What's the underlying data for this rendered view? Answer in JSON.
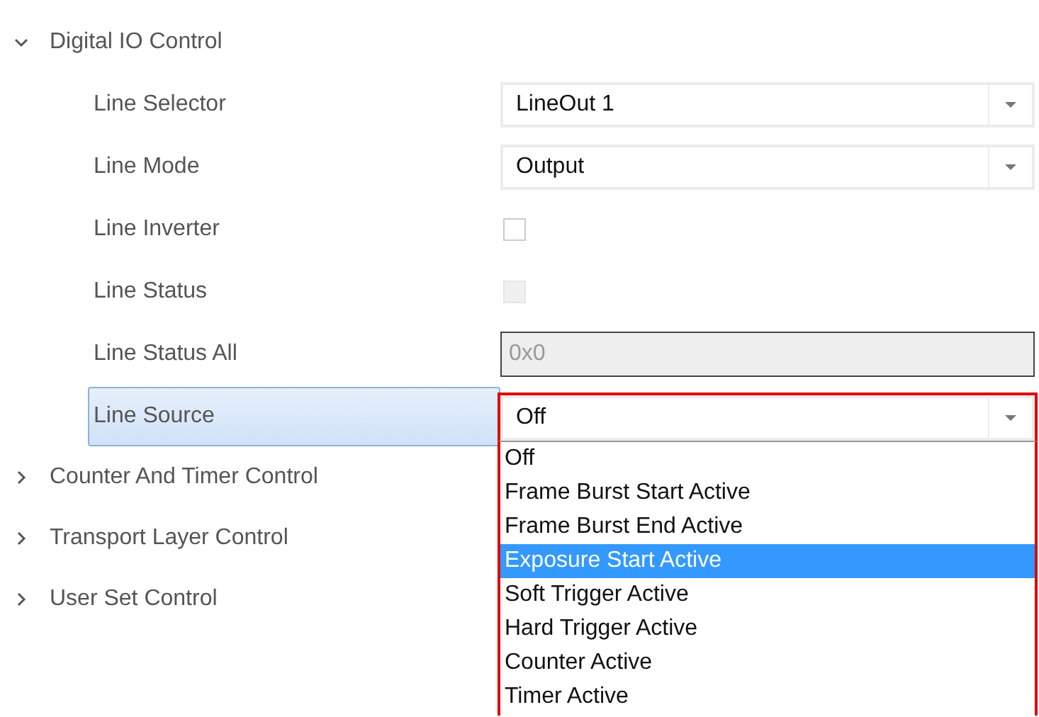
{
  "groups": [
    {
      "label": "Digital IO Control",
      "expanded": true,
      "properties": [
        {
          "kind": "dropdown",
          "label": "Line Selector",
          "value": "LineOut 1",
          "selected": false,
          "open": false
        },
        {
          "kind": "dropdown",
          "label": "Line Mode",
          "value": "Output",
          "selected": false,
          "open": false
        },
        {
          "kind": "checkbox",
          "label": "Line Inverter",
          "checked": false,
          "disabled": false,
          "selected": false
        },
        {
          "kind": "checkbox",
          "label": "Line Status",
          "checked": false,
          "disabled": true,
          "selected": false
        },
        {
          "kind": "readonly",
          "label": "Line Status All",
          "value": "0x0",
          "disabled": true,
          "selected": false
        },
        {
          "kind": "dropdown",
          "label": "Line Source",
          "value": "Off",
          "selected": true,
          "open": true,
          "options": [
            {
              "label": "Off",
              "highlighted": false
            },
            {
              "label": "Frame Burst Start Active",
              "highlighted": false
            },
            {
              "label": "Frame Burst End Active",
              "highlighted": false
            },
            {
              "label": "Exposure Start Active",
              "highlighted": true
            },
            {
              "label": "Soft Trigger Active",
              "highlighted": false
            },
            {
              "label": "Hard Trigger Active",
              "highlighted": false
            },
            {
              "label": "Counter Active",
              "highlighted": false
            },
            {
              "label": "Timer Active",
              "highlighted": false
            }
          ]
        }
      ]
    },
    {
      "label": "Counter And Timer Control",
      "expanded": false
    },
    {
      "label": "Transport Layer Control",
      "expanded": false
    },
    {
      "label": "User Set Control",
      "expanded": false
    }
  ]
}
